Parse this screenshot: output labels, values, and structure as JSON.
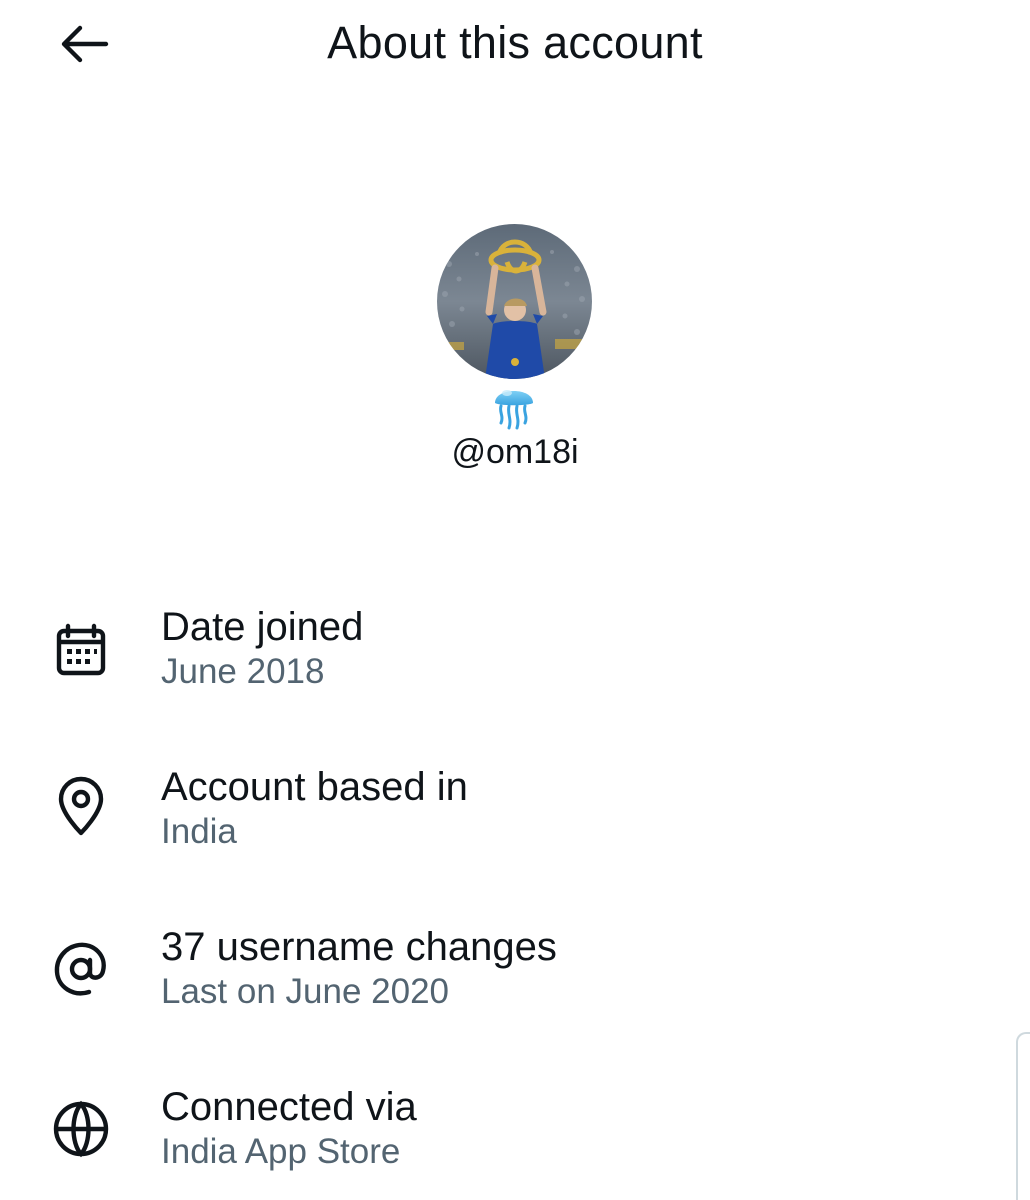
{
  "header": {
    "back_icon": "arrow-left-icon",
    "title": "About this account"
  },
  "profile": {
    "avatar_icon": "profile-photo",
    "badge_icon": "jellyfish-emoji-icon",
    "handle": "@om18i"
  },
  "info": [
    {
      "icon": "calendar-icon",
      "title": "Date joined",
      "value": "June 2018"
    },
    {
      "icon": "location-pin-icon",
      "title": "Account based in",
      "value": "India"
    },
    {
      "icon": "at-sign-icon",
      "title": "37 username changes",
      "value": "Last on June 2020"
    },
    {
      "icon": "globe-icon",
      "title": "Connected via",
      "value": "India App Store"
    }
  ],
  "colors": {
    "text_primary": "#0f1419",
    "text_secondary": "#536471",
    "background": "#ffffff"
  }
}
